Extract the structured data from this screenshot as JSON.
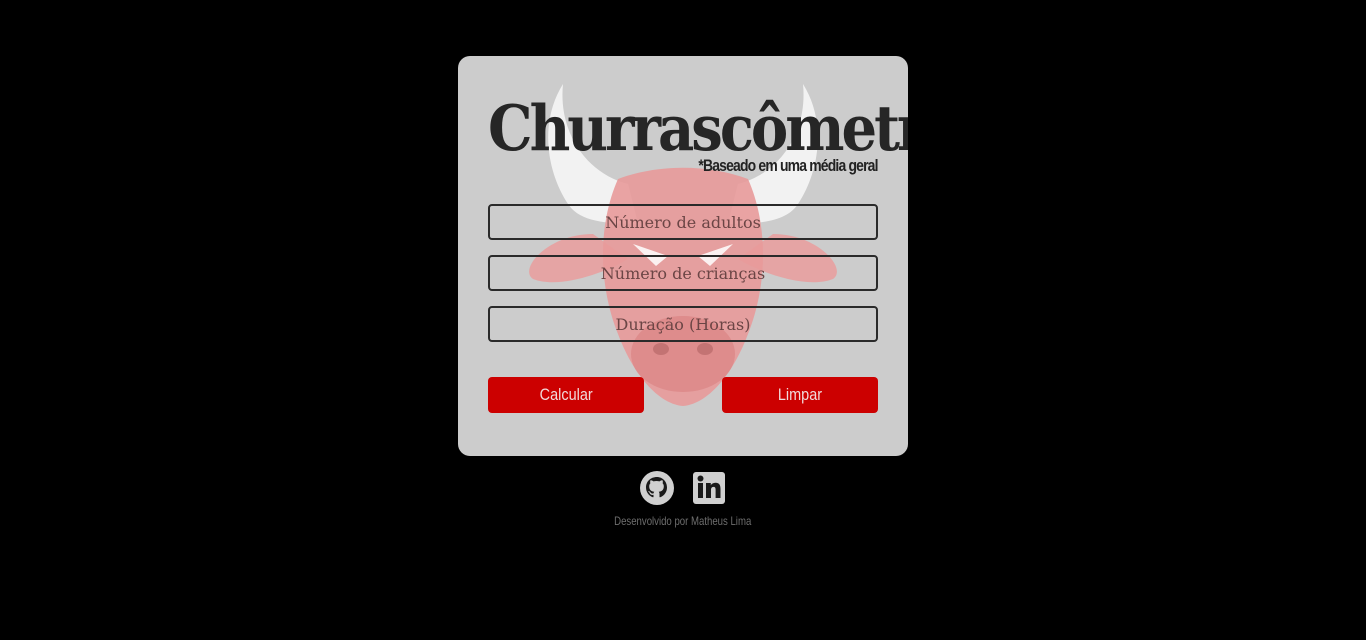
{
  "card": {
    "title": "Churrascômetro",
    "subtitle": "*Baseado em uma média geral",
    "background_logo_icon": "bull-head-icon"
  },
  "form": {
    "adults_placeholder": "Número de adultos",
    "children_placeholder": "Número de crianças",
    "duration_placeholder": "Duração (Horas)"
  },
  "buttons": {
    "calculate_label": "Calcular",
    "clear_label": "Limpar"
  },
  "social": {
    "github_icon": "github-icon",
    "linkedin_icon": "linkedin-icon"
  },
  "footer": {
    "credit": "Desenvolvido por Matheus Lima"
  },
  "colors": {
    "page_background": "#000000",
    "card_background": "#cccccc",
    "accent_red": "#cc0000",
    "text_dark": "#262626"
  }
}
